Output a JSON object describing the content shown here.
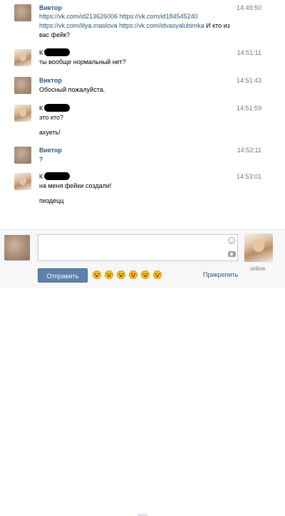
{
  "messages": [
    {
      "sender": "Виктор",
      "time": "14:49:50",
      "lines": [
        "https://vk.com/id213626006 https://vk.com/id184545240 https://vk.com/lilya.maslova https://vk.com/idvasyalubimka И кто из вас фейк?"
      ]
    },
    {
      "sender": "К",
      "time": "14:51:11",
      "lines": [
        "ты вообще нормальный нет?"
      ]
    },
    {
      "sender": "Виктор",
      "time": "14:51:43",
      "lines": [
        "Обосный пожалуйста."
      ]
    },
    {
      "sender": "К",
      "time": "14:51:59",
      "lines": [
        "это кто?",
        "ахуеть!"
      ]
    },
    {
      "sender": "Виктор",
      "time": "14:52:11",
      "lines": [
        "?"
      ]
    },
    {
      "sender": "К",
      "time": "14:53:01",
      "lines": [
        "на меня фейки создали!",
        "пиздецц"
      ]
    }
  ],
  "composer": {
    "input_value": "",
    "send_label": "Отправить",
    "attach_label": "Прикрепить",
    "partner_status": "online",
    "emoji_icons": [
      "smile-emoji",
      "laugh-emoji",
      "wink-emoji",
      "grin-emoji",
      "happy-emoji",
      "surprised-emoji"
    ]
  }
}
